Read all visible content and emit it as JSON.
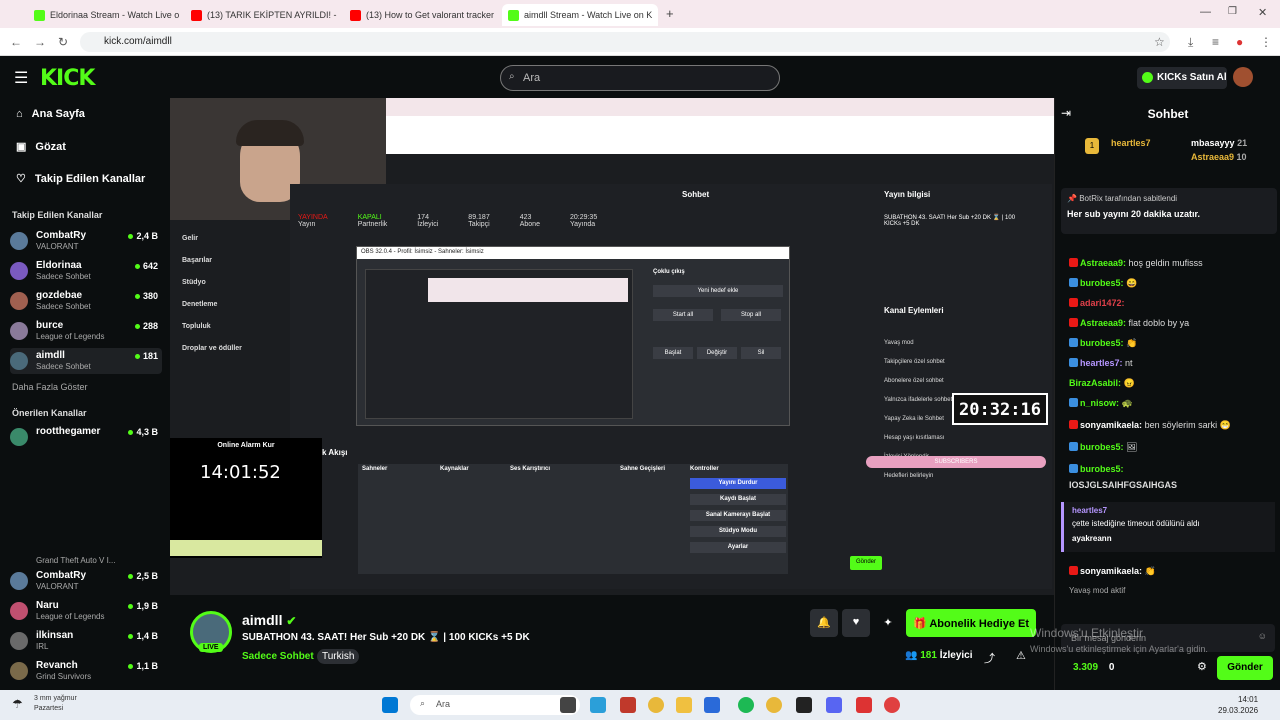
{
  "browser": {
    "tabs": [
      {
        "title": "Eldorinaa Stream - Watch Live o",
        "color": "#53fc18"
      },
      {
        "title": "(13) TARIK EKİPTEN AYRILDI! - Yo",
        "color": "#ff0000"
      },
      {
        "title": "(13) How to Get valorant tracker",
        "color": "#ff0000"
      },
      {
        "title": "aimdll Stream - Watch Live on K",
        "color": "#53fc18"
      }
    ],
    "url": "kick.com/aimdll"
  },
  "header": {
    "logo": "KICK",
    "search_placeholder": "Ara",
    "kicks_button": "KICKs Satın Al"
  },
  "sidebar": {
    "nav": [
      "Ana Sayfa",
      "Gözat",
      "Takip Edilen Kanallar"
    ],
    "followed_title": "Takip Edilen Kanallar",
    "followed": [
      {
        "name": "CombatRy",
        "category": "VALORANT",
        "viewers": "2,4 B",
        "color": "#5a7a9a"
      },
      {
        "name": "Eldorinaa",
        "category": "Sadece Sohbet",
        "viewers": "642",
        "color": "#7a5ac0"
      },
      {
        "name": "gozdebae",
        "category": "Sadece Sohbet",
        "viewers": "380",
        "color": "#a06050"
      },
      {
        "name": "burce",
        "category": "League of Legends",
        "viewers": "288",
        "color": "#8a7a9a"
      },
      {
        "name": "aimdll",
        "category": "Sadece Sohbet",
        "viewers": "181",
        "color": "#4a6a7a"
      }
    ],
    "show_more": "Daha Fazla Göster",
    "recommended_title": "Önerilen Kanallar",
    "recommended": [
      {
        "name": "rootthegamer",
        "category": "",
        "viewers": "4,3 B",
        "color": "#3a8a6a"
      },
      {
        "name": "CombatRy",
        "category": "VALORANT",
        "viewers": "2,5 B",
        "color": "#5a7a9a"
      },
      {
        "name": "Naru",
        "category": "League of Legends",
        "viewers": "1,9 B",
        "color": "#c05070"
      },
      {
        "name": "ilkinsan",
        "category": "IRL",
        "viewers": "1,4 B",
        "color": "#6a6a6a"
      },
      {
        "name": "Revanch",
        "category": "Grind Survivors",
        "viewers": "1,1 B",
        "color": "#7a6a4a"
      }
    ],
    "extra_category": "Grand Theft Auto V I..."
  },
  "video": {
    "overlay_clock": "20:32:16",
    "wall_clock_label": "Online Alarm Kur",
    "wall_clock": "14:01:52",
    "inner_menu": [
      "Gelir",
      "Başarılar",
      "Stüdyo",
      "Denetleme",
      "Topluluk",
      "Droplar ve ödüller"
    ],
    "inner_stats": [
      {
        "label": "Yayın",
        "value": "YAYINDA"
      },
      {
        "label": "Partnerlik",
        "value": "KAPALI"
      },
      {
        "label": "İzleyici",
        "value": "174"
      },
      {
        "label": "Takipçi",
        "value": "89.187"
      },
      {
        "label": "Abone",
        "value": "423"
      },
      {
        "label": "Yayında",
        "value": "20:29:35"
      }
    ],
    "inner_chat_title": "Sohbet",
    "inner_info_title": "Yayın bilgisi",
    "inner_info_text": "SUBATHON 43. SAAT! Her Sub +20 DK ⌛ | 100 KICKs +5 DK",
    "inner_channel_actions": "Kanal Eylemleri",
    "inner_actions": [
      "Yavaş mod",
      "Takipçilere özel sohbet",
      "Abonelere özel sohbet",
      "Yalnızca ifadelerle sohbet",
      "Yapay Zeka ile Sohbet",
      "Hesap yaşı kısıtlaması",
      "İzleyici Yönlendir",
      "Hedefleri belirleyin"
    ],
    "obs_title": "OBS 32.0.4 - Profil: İsimsiz - Sahneler: İsimsiz",
    "obs_panels": [
      "Sahneler",
      "Kaynaklar",
      "Ses Karıştırıcı",
      "Sahne Geçişleri",
      "Kontroller"
    ],
    "obs_controls": [
      "Yayını Durdur",
      "Kaydı Başlat",
      "Sanal Kamerayı Başlat",
      "Stüdyo Modu",
      "Ayarlar"
    ],
    "obs_dialog": "Çoklu çıkış",
    "obs_dialog_buttons": [
      "Yeni hedef ekle",
      "Start all",
      "Stop all",
      "Başlat",
      "Değiştir",
      "Sil"
    ],
    "subscribers_label": "SUBSCRIBERS",
    "inner_send": "Gönder",
    "inner_activity": "Etkinlik Akışı"
  },
  "stream": {
    "channel": "aimdll",
    "live": "LIVE",
    "title": "SUBATHON 43. SAAT! Her Sub +20 DK ⌛ | 100 KICKs +5 DK",
    "category": "Sadece Sohbet",
    "language": "Turkish",
    "subscribe_gift": "Abonelik Hediye Et",
    "viewers": "181",
    "viewers_label": "İzleyici"
  },
  "chat": {
    "title": "Sohbet",
    "top_gifters": [
      {
        "name": "heartles7",
        "rank": "1"
      },
      {
        "name": "mbasayyy",
        "count": "21"
      },
      {
        "name": "Astraeaa9",
        "count": "10"
      }
    ],
    "pinned_by": "BotRix tarafından sabitlendi",
    "pinned_text": "Her sub yayını 20 dakika uzatır.",
    "messages": [
      {
        "user": "Astraeaa9:",
        "text": "hoş geldin mufisss",
        "color": "#53fc18"
      },
      {
        "user": "burobes5:",
        "text": "😄",
        "color": "#53fc18"
      },
      {
        "user": "adari1472:",
        "text": "",
        "color": "#e0404a"
      },
      {
        "user": "Astraeaa9:",
        "text": "flat doblo by ya",
        "color": "#53fc18"
      },
      {
        "user": "burobes5:",
        "text": "👏",
        "color": "#53fc18"
      },
      {
        "user": "heartles7:",
        "text": "nt",
        "color": "#b596ff"
      },
      {
        "user": "BirazAsabil:",
        "text": "😠",
        "color": "#53fc18"
      },
      {
        "user": "n_nisow:",
        "text": "🐢",
        "color": "#53fc18"
      },
      {
        "user": "sonyamikaela:",
        "text": "ben söylerim sarki 😁",
        "color": "#ffffff"
      },
      {
        "user": "burobes5:",
        "text": "🖼",
        "color": "#53fc18"
      },
      {
        "user": "burobes5:",
        "text": "",
        "color": "#53fc18"
      },
      {
        "user": "",
        "text": "IOSJGLSAIHFGSAIHGAS",
        "color": "#ffffff"
      }
    ],
    "highlight_user": "heartles7",
    "highlight_text": "çette istediğine timeout ödülünü aldı",
    "highlight_target": "ayakreann",
    "last_user": "sonyamikaela:",
    "last_text": "👏",
    "slow_mode": "Yavaş mod aktif",
    "input_placeholder": "Bir mesaj gönderin",
    "points": "3.309",
    "kicks_count": "0",
    "send": "Gönder"
  },
  "overlay": {
    "activate_title": "Windows'u Etkinleştir",
    "activate_text": "Windows'u etkinleştirmek için Ayarlar'a gidin."
  },
  "taskbar": {
    "weather_top": "3 mm yağmur",
    "weather_bottom": "Pazartesi",
    "search": "Ara",
    "time": "14:01",
    "date": "29.03.2026"
  }
}
